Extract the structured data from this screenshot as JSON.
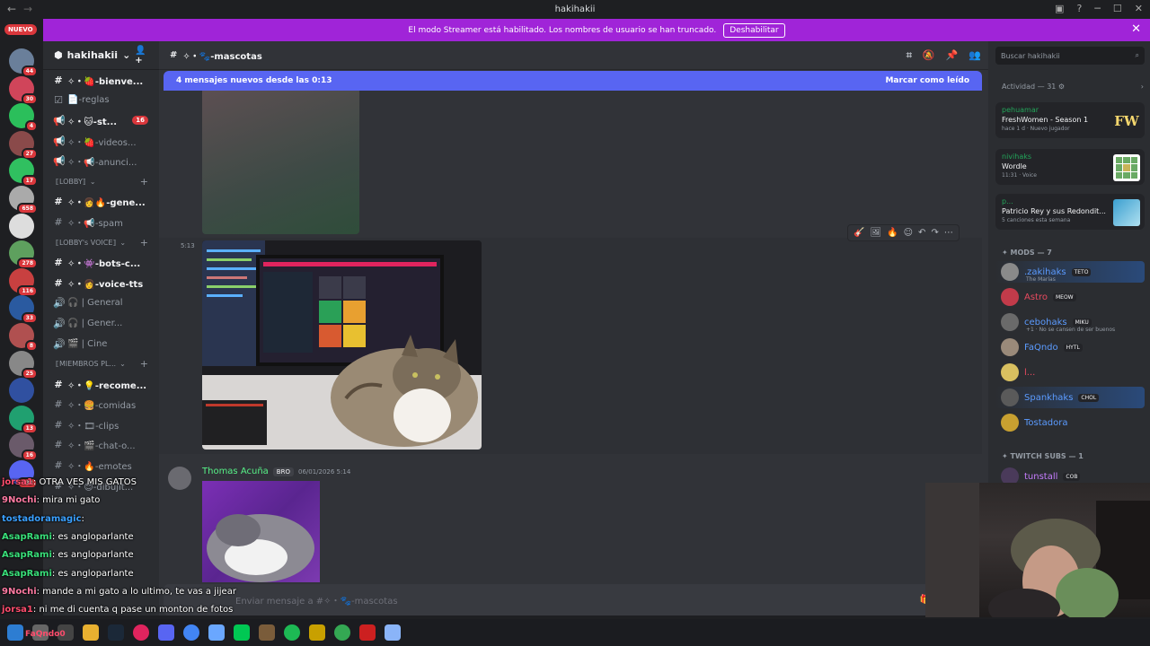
{
  "window": {
    "title": "hakihakii"
  },
  "banner": {
    "text": "El modo Streamer está habilitado. Los nombres de usuario se han truncado.",
    "button": "Deshabilitar"
  },
  "server_rail": {
    "new_label": "NUEVO",
    "badges": [
      "44",
      "30",
      "4",
      "27",
      "17",
      "658",
      "",
      "278",
      "116",
      "33",
      "8",
      "25",
      "",
      "13",
      "16",
      "331"
    ]
  },
  "guild": {
    "name": "hakihakii"
  },
  "channels": [
    {
      "type": "text",
      "name": "✧・🍓-bienve...",
      "unread": true
    },
    {
      "type": "rules",
      "name": "📄-reglas",
      "unread": false
    },
    {
      "type": "voice-announce",
      "name": "✧・🐱-st...",
      "unread": true,
      "count": "16"
    },
    {
      "type": "voice-announce",
      "name": "✧・🍓-videos...",
      "unread": false
    },
    {
      "type": "voice-announce",
      "name": "✧・📢-anunci...",
      "unread": false
    }
  ],
  "category_lobby": "⟦LOBBY⟧",
  "lobby_channels": [
    {
      "type": "text",
      "name": "✧・👩‍🔥-gene...",
      "unread": true
    },
    {
      "type": "text",
      "name": "✧・📢-spam",
      "unread": false
    }
  ],
  "category_voice": "⟦LOBBY's VOICE⟧",
  "voice_channels": [
    {
      "type": "text",
      "name": "✧・👾-bots-c...",
      "unread": true
    },
    {
      "type": "text",
      "name": "✧・👩-voice-tts",
      "unread": true
    },
    {
      "type": "voice",
      "name": "🎧 | General",
      "unread": false
    },
    {
      "type": "voice",
      "name": "🎧 | Gener...",
      "unread": false
    },
    {
      "type": "voice",
      "name": "🎬 | Cine",
      "unread": false
    }
  ],
  "category_members": "⟦MIEMBROS PL...",
  "member_channels": [
    {
      "type": "text",
      "name": "✧・💡-recome...",
      "unread": true
    },
    {
      "type": "text",
      "name": "✧・🍔-comidas",
      "unread": false
    },
    {
      "type": "text",
      "name": "✧・🎞-clips",
      "unread": false
    },
    {
      "type": "text",
      "name": "✧・🎬-chat-o...",
      "unread": false
    },
    {
      "type": "text",
      "name": "✧・🔥-emotes",
      "unread": false
    },
    {
      "type": "text",
      "name": "✧・😊-dibujit...",
      "unread": false
    }
  ],
  "chat": {
    "channel": "✧・🐾-mascotas",
    "new_messages": "4 mensajes nuevos desde las 0:13",
    "mark_read": "Marcar como leído",
    "timestamp": "5:13",
    "author": "Thomas Acuña",
    "author_tag": "BRO",
    "date": "06/01/2026 5:14",
    "input_placeholder": "Enviar mensaje a #✧・🐾-mascotas"
  },
  "members": {
    "search_placeholder": "Buscar hakihakii",
    "activity_header": "Actividad — 31",
    "activities": [
      {
        "user": "pehuamar",
        "title": "FreshWomen - Season 1",
        "sub": "hace 1 d · Nuevo jugador",
        "art": "FW"
      },
      {
        "user": "nivihaks",
        "title": "Wordle",
        "sub": "11:31 · Voice",
        "art": ""
      },
      {
        "user": "p...",
        "title": "Patricio Rey y sus Redondit...",
        "sub": "5 canciones esta semana",
        "art": ""
      }
    ],
    "mods_header": "✦ MODS — 7",
    "mods": [
      {
        "name": ".zakihaks",
        "tag": "TETO",
        "sub": "The Marías",
        "color": "#5b9bff"
      },
      {
        "name": "Astro",
        "tag": "MEOW",
        "sub": "",
        "color": "#e84a5f"
      },
      {
        "name": "cebohaks",
        "tag": "MIKU",
        "sub": "+1 · No se cansen de ser buenos",
        "color": "#5b9bff"
      },
      {
        "name": "FaQndo",
        "tag": "HYTL",
        "sub": "",
        "color": "#5b9bff"
      },
      {
        "name": "l...",
        "tag": "",
        "sub": "",
        "color": "#e84a5f"
      },
      {
        "name": "Spankhaks",
        "tag": "CHOL",
        "sub": "",
        "color": "#5b9bff"
      },
      {
        "name": "Tostadora",
        "tag": "",
        "sub": "",
        "color": "#5b9bff"
      }
    ],
    "subs_header": "✦ TWITCH SUBS — 1",
    "subs": [
      {
        "name": "tunstall",
        "tag": "COB",
        "color": "#c77dff"
      }
    ]
  },
  "stream_chat": [
    {
      "user": "jorsa1",
      "color": "#ff4d6d",
      "text": ": OTRA VES MIS GATOS"
    },
    {
      "user": "9Nochi",
      "color": "#ff7aa2",
      "text": ": mira mi gato"
    },
    {
      "user": "tostadoramagic",
      "color": "#3aa0ff",
      "text": ":"
    },
    {
      "user": "AsapRami",
      "color": "#39e07a",
      "text": ": es angloparlante"
    },
    {
      "user": "AsapRami",
      "color": "#39e07a",
      "text": ": es angloparlante"
    },
    {
      "user": "AsapRami",
      "color": "#39e07a",
      "text": ": es angloparlante"
    },
    {
      "user": "9Nochi",
      "color": "#ff7aa2",
      "text": ": mande a mi gato a lo ultimo, te vas a jijear"
    },
    {
      "user": "jorsa1",
      "color": "#ff4d6d",
      "text": ": ni me di cuenta q pase un monton de fotos"
    }
  ],
  "taskbar": {
    "overlay_user": "FaQndo0"
  }
}
